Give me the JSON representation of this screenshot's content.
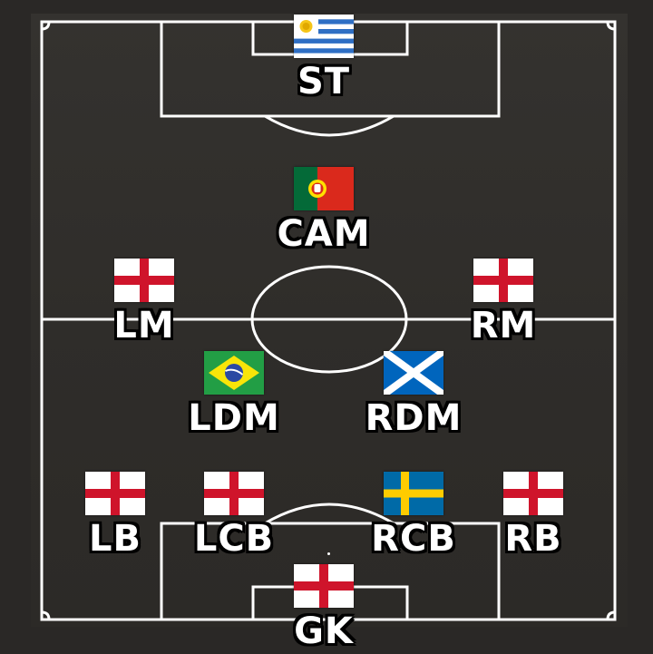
{
  "formation": {
    "players": [
      {
        "id": "st",
        "position": "ST",
        "flag": "uruguay-flag"
      },
      {
        "id": "cam",
        "position": "CAM",
        "flag": "portugal-flag"
      },
      {
        "id": "lm",
        "position": "LM",
        "flag": "england-flag"
      },
      {
        "id": "rm",
        "position": "RM",
        "flag": "england-flag"
      },
      {
        "id": "ldm",
        "position": "LDM",
        "flag": "brazil-flag"
      },
      {
        "id": "rdm",
        "position": "RDM",
        "flag": "scotland-flag"
      },
      {
        "id": "lb",
        "position": "LB",
        "flag": "england-flag"
      },
      {
        "id": "lcb",
        "position": "LCB",
        "flag": "england-flag"
      },
      {
        "id": "rcb",
        "position": "RCB",
        "flag": "sweden-flag"
      },
      {
        "id": "rb",
        "position": "RB",
        "flag": "england-flag"
      },
      {
        "id": "gk",
        "position": "GK",
        "flag": "england-flag"
      }
    ]
  },
  "colors": {
    "pitch": "#302e2b",
    "lines": "#ffffff",
    "label_outline": "#000000"
  }
}
